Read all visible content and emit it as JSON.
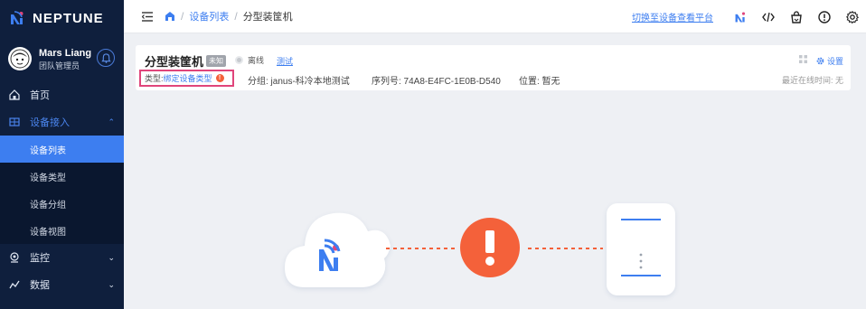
{
  "brand": {
    "name": "NEPTUNE"
  },
  "user": {
    "name": "Mars Liang",
    "role": "团队管理员"
  },
  "sidebar": {
    "items": [
      {
        "label": "首页"
      },
      {
        "label": "设备接入"
      },
      {
        "label": "监控"
      },
      {
        "label": "数据"
      }
    ],
    "sub_items": [
      {
        "label": "设备列表"
      },
      {
        "label": "设备类型"
      },
      {
        "label": "设备分组"
      },
      {
        "label": "设备视图"
      }
    ]
  },
  "header": {
    "breadcrumb": {
      "list": "设备列表",
      "current": "分型装筐机"
    },
    "switch_link": "切换至设备查看平台"
  },
  "device": {
    "name": "分型装筐机",
    "tag": "未知",
    "status": "离线",
    "test_link": "测试",
    "type_label": "类型:",
    "type_value": "绑定设备类型",
    "group": "分组:  janus-科冷本地测试",
    "serial": "序列号:  74A8-E4FC-1E0B-D540",
    "location": "位置:  暂无",
    "settings": "设置",
    "last_online": "最近在线时间: 无"
  },
  "colors": {
    "accent": "#3d7ef0",
    "sidebar_bg": "#0f1f3d",
    "warning": "#f4613a",
    "highlight_border": "#e0457b"
  }
}
